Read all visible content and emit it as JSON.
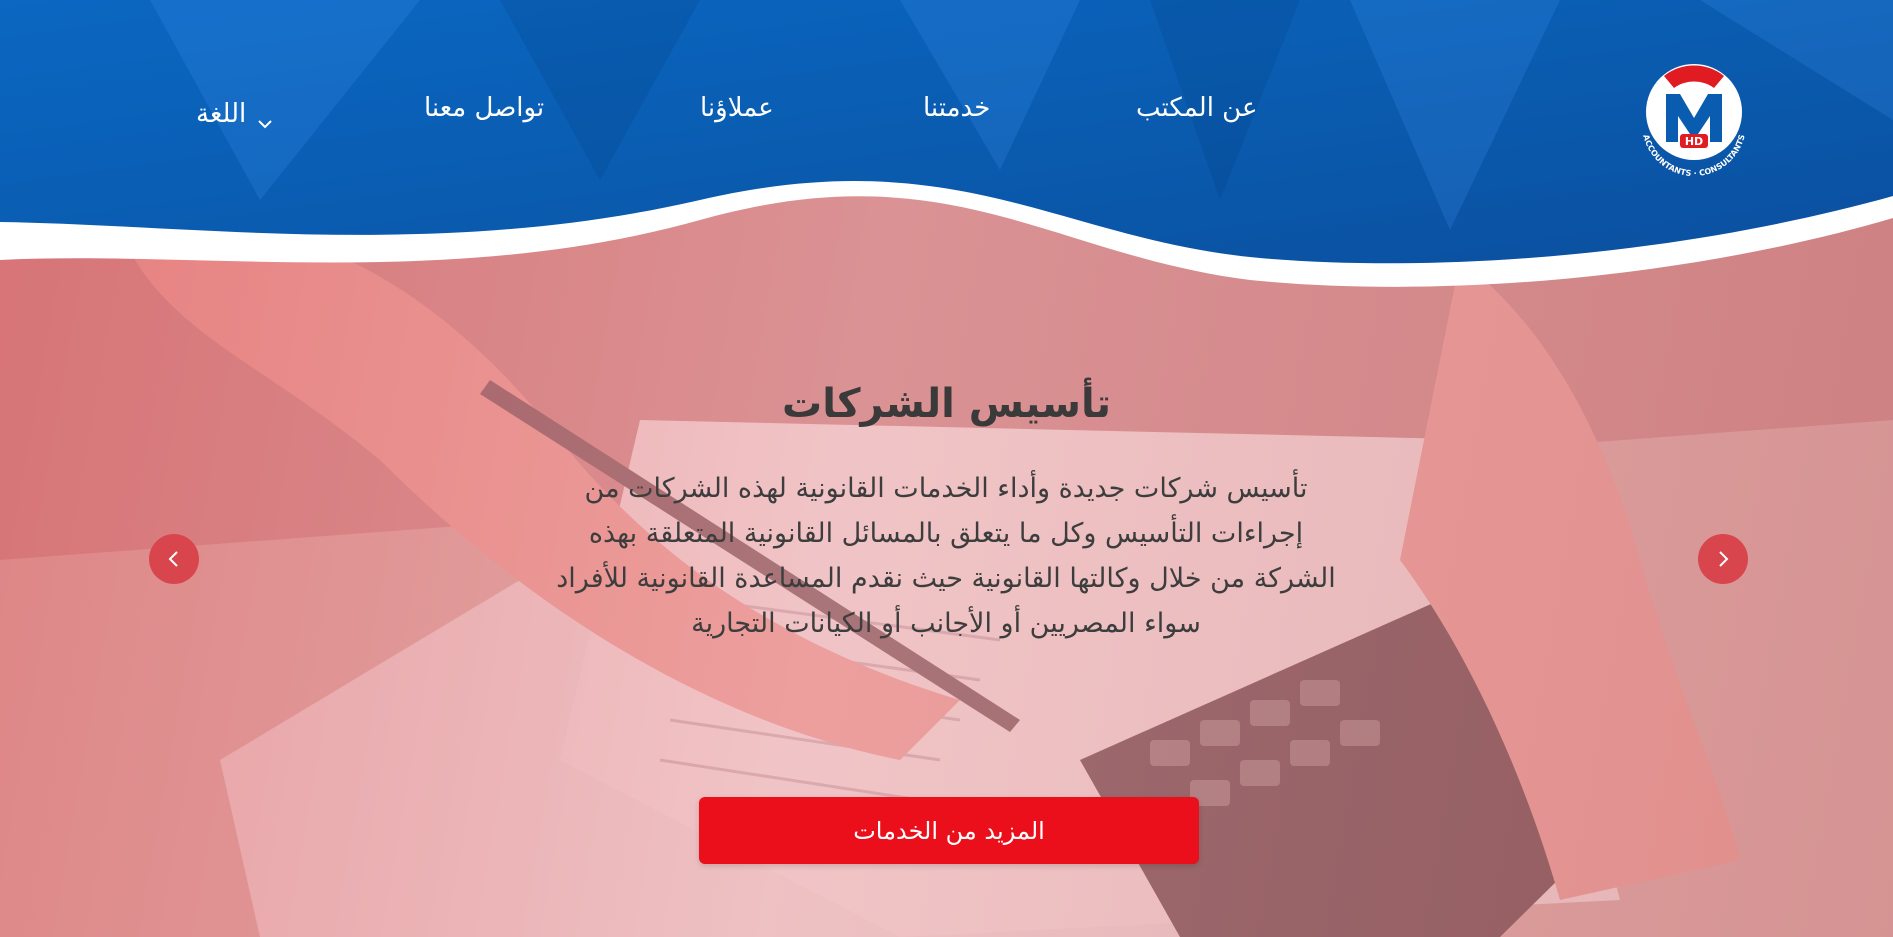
{
  "brand": {
    "logo_initials": "HD",
    "logo_text": "ACCOUNTANTS · CONSULTANTS",
    "logo_icon": "m-monogram-logo"
  },
  "nav": {
    "items": [
      {
        "label": "عن المكتب"
      },
      {
        "label": "خدمتنا"
      },
      {
        "label": "عملاؤنا"
      },
      {
        "label": "تواصل معنا"
      }
    ],
    "language": {
      "label": "اللغة",
      "icon": "chevron-down-icon"
    }
  },
  "hero": {
    "title": "تأسيس الشركات",
    "description": "تأسيس شركات جديدة وأداء الخدمات القانونية لهذه الشركات من إجراءات التأسيس وكل ما يتعلق بالمسائل القانونية المتعلقة بهذه الشركة من خلال وكالتها القانونية حيث نقدم المساعدة القانونية للأفراد سواء المصريين أو الأجانب أو الكيانات التجارية",
    "cta_label": "المزيد من الخدمات",
    "prev_icon": "chevron-left-icon",
    "next_icon": "chevron-right-icon"
  },
  "colors": {
    "header_blue": "#0a5cb0",
    "accent_red": "#ea0f1a",
    "arrow_red": "#d9454d",
    "overlay_pink": "#e8a7a6"
  }
}
